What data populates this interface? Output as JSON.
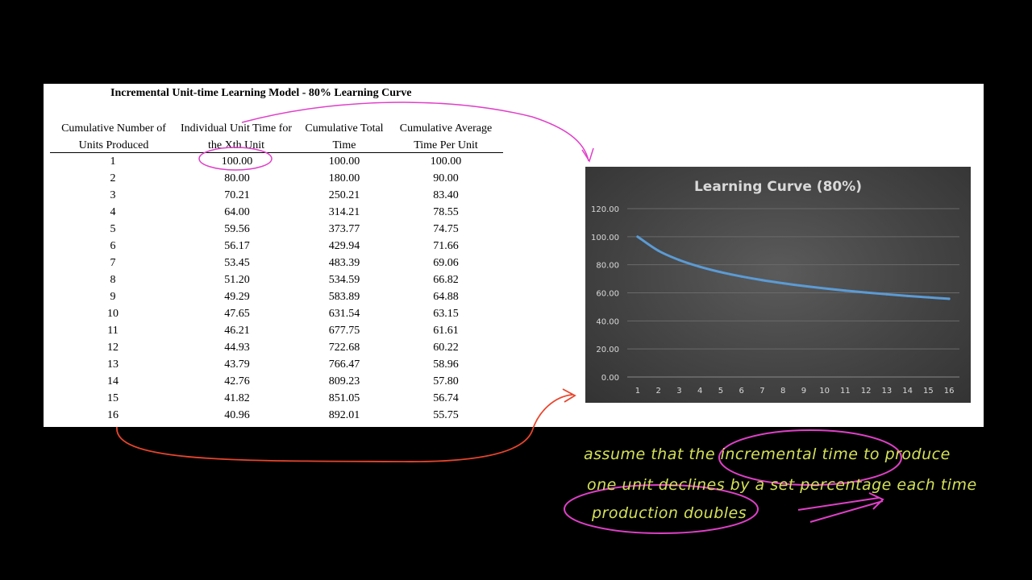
{
  "table": {
    "title": "Incremental Unit-time Learning Model - 80% Learning Curve",
    "headers": [
      [
        "Cumulative Number of",
        "Units Produced"
      ],
      [
        "Individual Unit Time for",
        "the Xth Unit"
      ],
      [
        "Cumulative Total",
        "Time"
      ],
      [
        "Cumulative Average",
        "Time Per Unit"
      ]
    ],
    "rows": [
      [
        "1",
        "100.00",
        "100.00",
        "100.00"
      ],
      [
        "2",
        "80.00",
        "180.00",
        "90.00"
      ],
      [
        "3",
        "70.21",
        "250.21",
        "83.40"
      ],
      [
        "4",
        "64.00",
        "314.21",
        "78.55"
      ],
      [
        "5",
        "59.56",
        "373.77",
        "74.75"
      ],
      [
        "6",
        "56.17",
        "429.94",
        "71.66"
      ],
      [
        "7",
        "53.45",
        "483.39",
        "69.06"
      ],
      [
        "8",
        "51.20",
        "534.59",
        "66.82"
      ],
      [
        "9",
        "49.29",
        "583.89",
        "64.88"
      ],
      [
        "10",
        "47.65",
        "631.54",
        "63.15"
      ],
      [
        "11",
        "46.21",
        "677.75",
        "61.61"
      ],
      [
        "12",
        "44.93",
        "722.68",
        "60.22"
      ],
      [
        "13",
        "43.79",
        "766.47",
        "58.96"
      ],
      [
        "14",
        "42.76",
        "809.23",
        "57.80"
      ],
      [
        "15",
        "41.82",
        "851.05",
        "56.74"
      ],
      [
        "16",
        "40.96",
        "892.01",
        "55.75"
      ]
    ]
  },
  "chart_data": {
    "type": "line",
    "title": "Learning Curve (80%)",
    "x": [
      1,
      2,
      3,
      4,
      5,
      6,
      7,
      8,
      9,
      10,
      11,
      12,
      13,
      14,
      15,
      16
    ],
    "y_tick_labels": [
      "0.00",
      "20.00",
      "40.00",
      "60.00",
      "80.00",
      "100.00",
      "120.00"
    ],
    "ylim": [
      0,
      120
    ],
    "grid": true,
    "series": [
      {
        "values": [
          100.0,
          90.0,
          83.4,
          78.55,
          74.75,
          71.66,
          69.06,
          66.82,
          64.88,
          63.15,
          61.61,
          60.22,
          58.96,
          57.8,
          56.74,
          55.75
        ]
      }
    ],
    "colors": {
      "line": "#5b9bd5",
      "gridline": "#6a6a6a",
      "text": "#d9d9d9"
    }
  },
  "annotations": {
    "lines": [
      "assume that the incremental time to produce",
      "one unit declines by a set percentage each time",
      "production doubles"
    ],
    "colors": {
      "pink": "#e040c8",
      "red": "#e8452c",
      "yellow": "#d4e157"
    }
  }
}
